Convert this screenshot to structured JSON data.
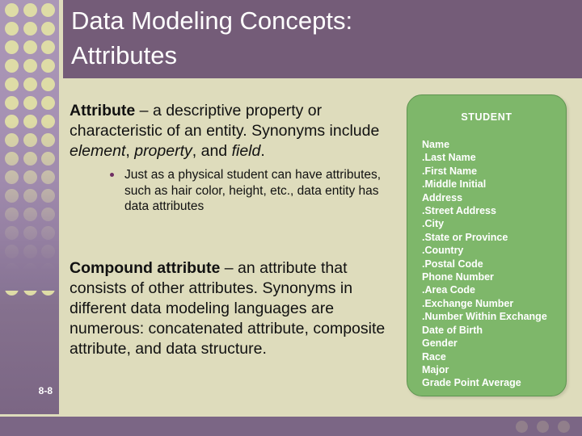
{
  "slide": {
    "title": "Data Modeling Concepts:\nAttributes",
    "page_number": "8-8",
    "colors": {
      "header_purple": "#745C78",
      "body_beige": "#DEDCBC",
      "entity_green": "#7EB76A",
      "sidebar_purple": "#A894B4",
      "sidebar_dot": "#DEDCA6",
      "bullet_purple": "#6E2E63"
    }
  },
  "content": {
    "paragraph1": {
      "term": "Attribute",
      "dash": " – ",
      "text_a": "a descriptive property or characteristic of an entity. Synonyms include ",
      "em1": "element",
      "sep1": ", ",
      "em2": "property",
      "sep2": ", and ",
      "em3": "field",
      "text_b": "."
    },
    "sub_bullets": [
      "Just as a physical student can have attributes, such as hair color, height, etc., data entity has data attributes"
    ],
    "paragraph2": {
      "term": "Compound attribute",
      "dash": " – ",
      "text": "an attribute that consists of other attributes. Synonyms in different data modeling languages are numerous: concatenated attribute, composite attribute, and data structure."
    }
  },
  "entity": {
    "name": "STUDENT",
    "attributes": [
      "Name",
      ".Last Name",
      ".First Name",
      ".Middle Initial",
      "Address",
      ".Street Address",
      ".City",
      ".State or Province",
      ".Country",
      ".Postal Code",
      "Phone Number",
      ".Area Code",
      ".Exchange Number",
      ".Number Within Exchange",
      "Date of Birth",
      "Gender",
      "Race",
      "Major",
      "Grade Point Average"
    ]
  }
}
